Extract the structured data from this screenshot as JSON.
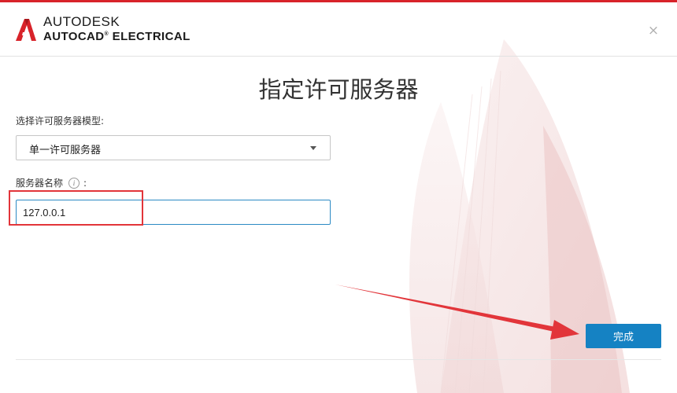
{
  "header": {
    "brand_top": "AUTODESK",
    "brand_bottom": "AUTOCAD",
    "brand_product": " ELECTRICAL",
    "close_symbol": "×",
    "logo_icon": "autodesk-a-logo"
  },
  "dialog": {
    "title": "指定许可服务器",
    "model_label": "选择许可服务器模型:",
    "model_value": "单一许可服务器",
    "server_label": "服务器名称",
    "server_label_suffix": ":",
    "info_symbol": "i",
    "server_value": "127.0.0.1",
    "finish_label": "完成"
  },
  "colors": {
    "brand_red": "#d8232a",
    "primary_button": "#1582c3",
    "input_focus_border": "#2b8ac4",
    "annotation_red": "#e2353a"
  },
  "icons": {
    "close": "close-icon",
    "info": "info-icon",
    "dropdown": "chevron-down-icon"
  }
}
